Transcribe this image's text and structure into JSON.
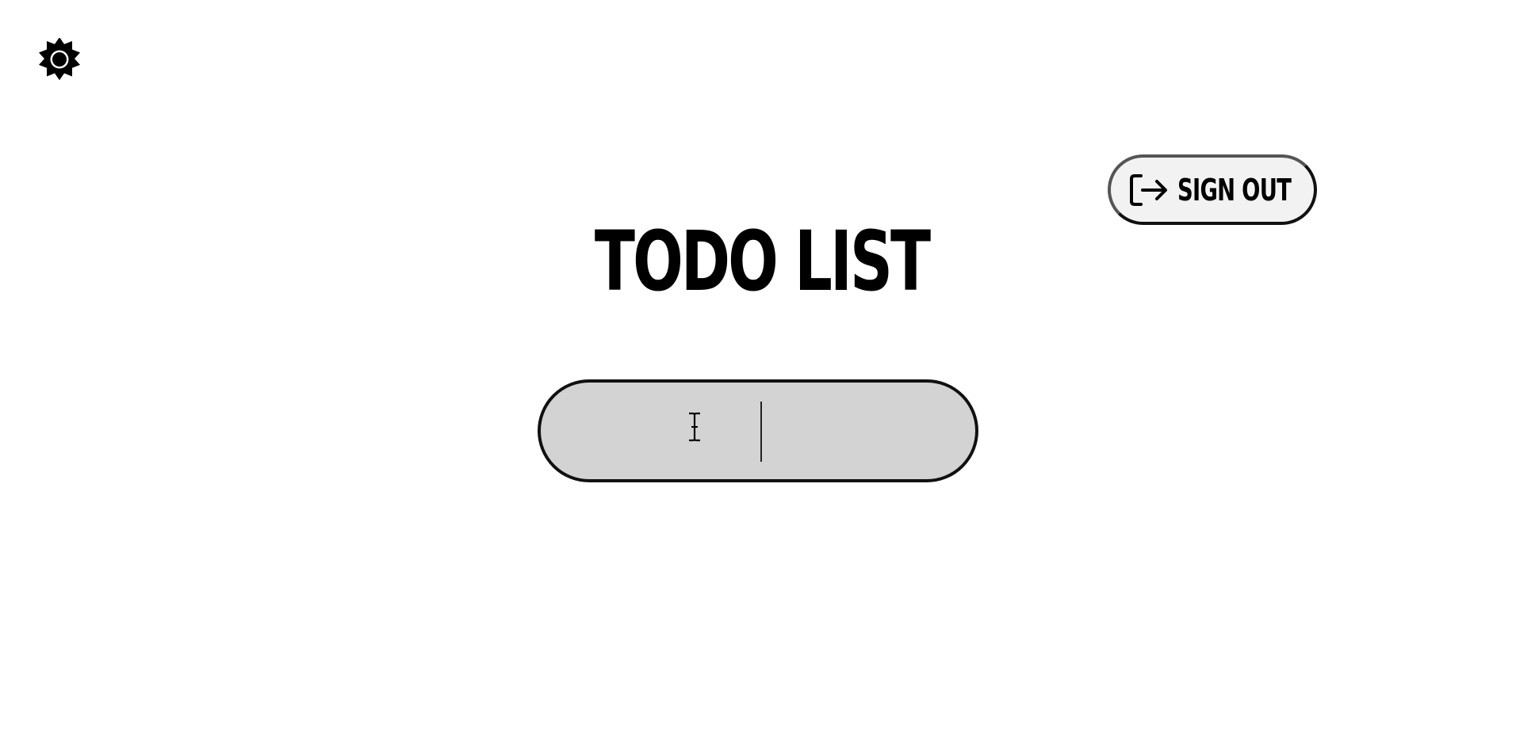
{
  "header": {
    "theme_toggle_icon": "sun-icon",
    "signout": {
      "label": "SIGN OUT",
      "icon": "sign-out-icon"
    }
  },
  "main": {
    "title": "TODO LIST",
    "todo_input": {
      "value": "",
      "placeholder": ""
    }
  },
  "colors": {
    "background": "#ffffff",
    "input_background": "#d3d3d3",
    "border": "#111111",
    "text": "#000000"
  }
}
